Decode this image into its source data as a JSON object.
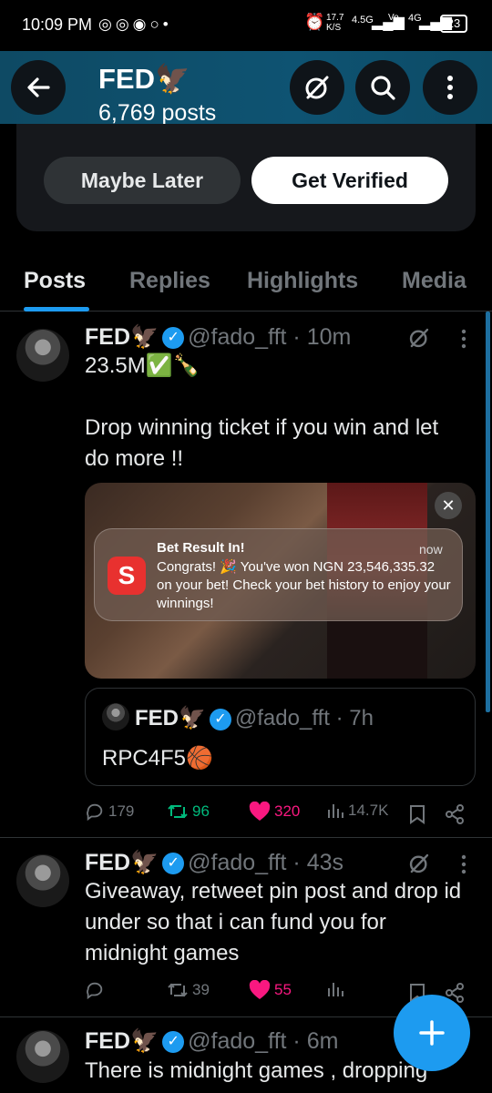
{
  "status_bar": {
    "time": "10:09 PM",
    "net_speed": "17.7 K/S",
    "network": "4.5G",
    "volte": "Vo LTE",
    "network2": "4G",
    "battery": "23"
  },
  "header": {
    "title": "FED🦅",
    "subtitle": "6,769 posts"
  },
  "promo": {
    "maybe_later": "Maybe Later",
    "get_verified": "Get Verified"
  },
  "tabs": [
    "Posts",
    "Replies",
    "Highlights",
    "Media"
  ],
  "posts": [
    {
      "name": "FED🦅",
      "handle": "@fado_fft",
      "time": "· 10m",
      "text_line1": "23.5M✅🍾",
      "text_line2": "Drop winning ticket if you win and let do more !!",
      "notification": {
        "title": "Bet Result In!",
        "when": "now",
        "body": "Congrats! 🎉 You've won NGN 23,546,335.32 on your bet! Check your bet history to enjoy your winnings!"
      },
      "quote": {
        "name": "FED🦅",
        "handle": "@fado_fft",
        "time": "· 7h",
        "text": "RPC4F5🏀"
      },
      "replies": "179",
      "reposts": "96",
      "likes": "320",
      "views": "14.7K"
    },
    {
      "name": "FED🦅",
      "handle": "@fado_fft",
      "time": "· 43s",
      "text": "Giveaway, retweet pin post and drop id under so that i can fund you for midnight games",
      "reposts": "39",
      "likes": "55"
    },
    {
      "name": "FED🦅",
      "handle": "@fado_fft",
      "time": "· 6m",
      "text": "There is midnight games , dropping"
    }
  ],
  "colors": {
    "accent": "#1d9bf0",
    "like": "#f91880",
    "repost": "#00ba7c",
    "header": "#0e4a64"
  }
}
